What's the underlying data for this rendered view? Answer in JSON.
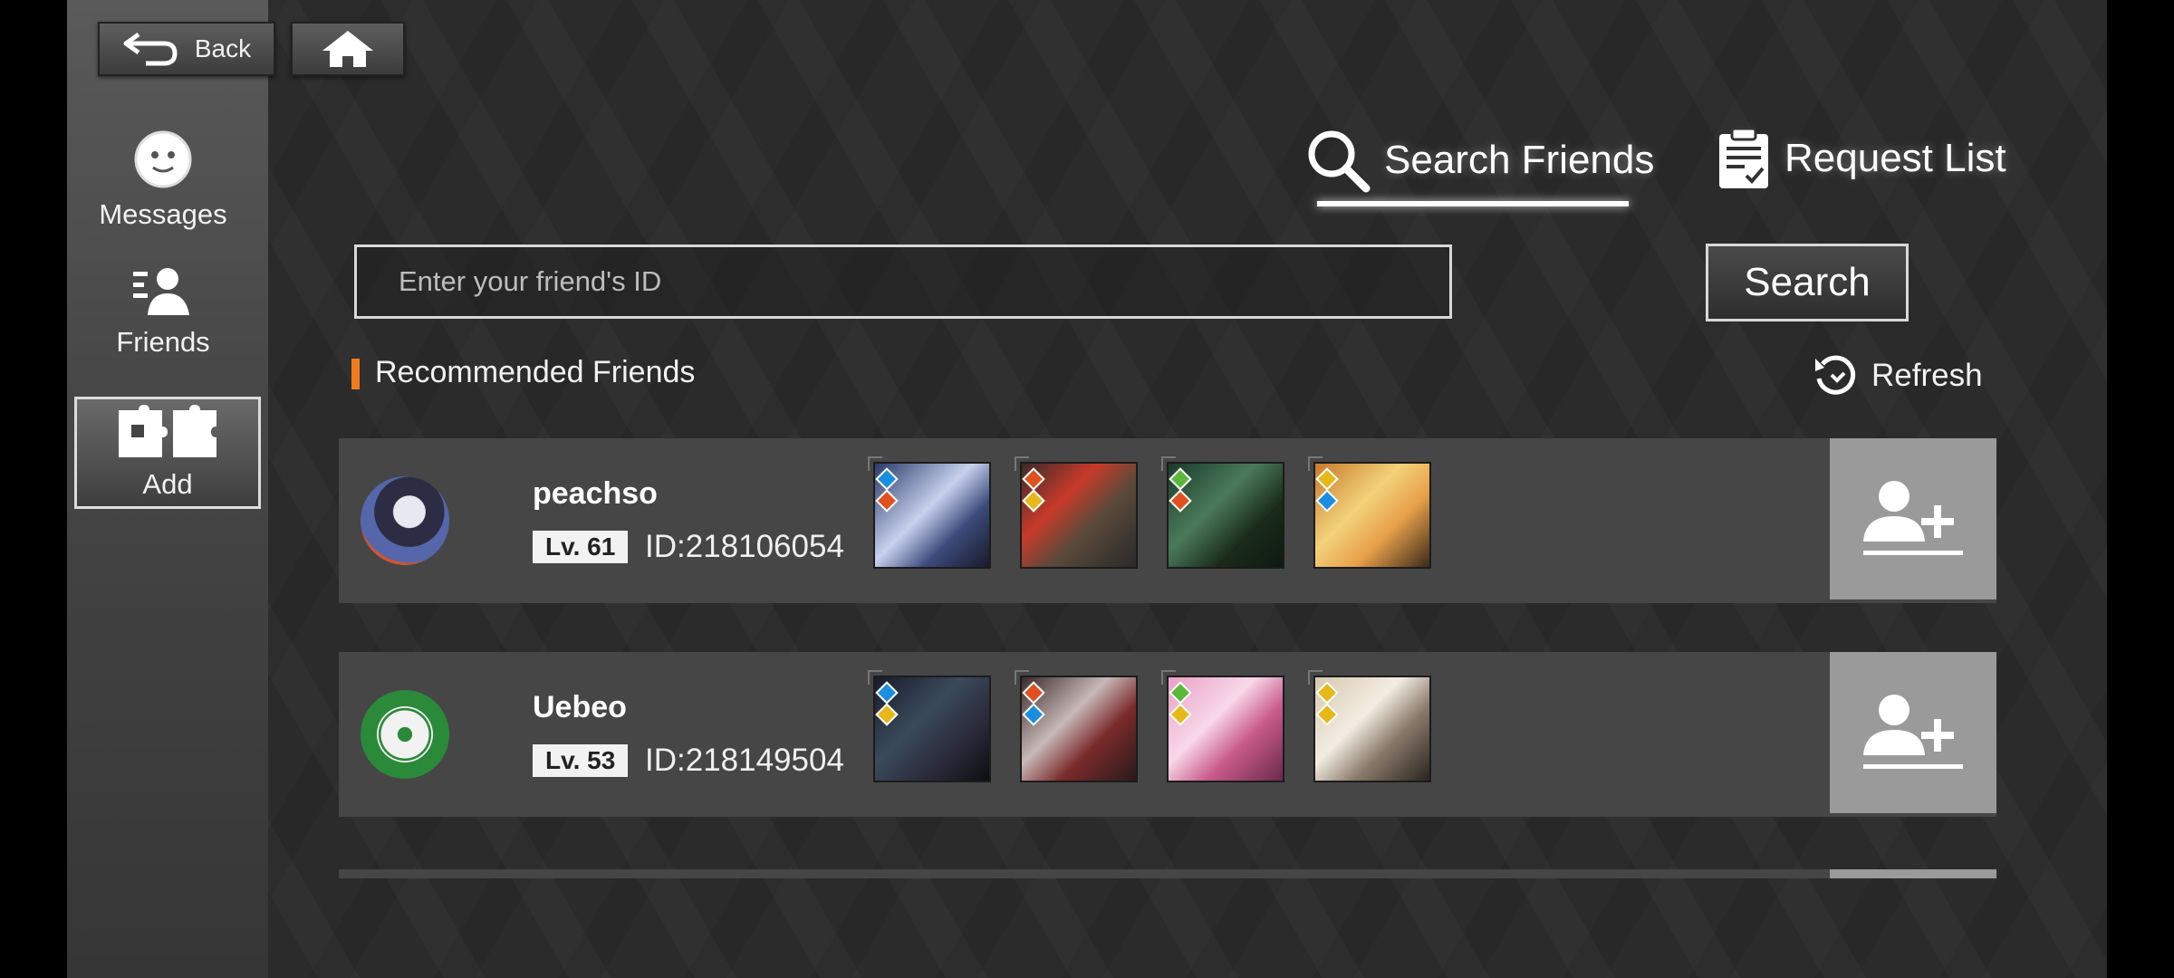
{
  "nav": {
    "back_label": "Back",
    "home_icon": "home-icon",
    "items": [
      {
        "label": "Messages",
        "icon": "smiley-icon"
      },
      {
        "label": "Friends",
        "icon": "friends-icon"
      },
      {
        "label": "Add",
        "icon": "puzzle-icon",
        "selected": true
      }
    ]
  },
  "tabs": {
    "search_label": "Search Friends",
    "request_label": "Request List",
    "active": "Search Friends"
  },
  "search": {
    "placeholder": "Enter your friend's ID",
    "value": "",
    "button_label": "Search"
  },
  "recommended": {
    "title": "Recommended Friends",
    "refresh_label": "Refresh",
    "accent_color": "#f07c1b",
    "players": [
      {
        "name": "peachso",
        "level": "Lv. 61",
        "id_text": "ID:218106054",
        "team_elements": [
          [
            "blue",
            "red"
          ],
          [
            "red",
            "yellow"
          ],
          [
            "green",
            "red"
          ],
          [
            "yellow",
            "blue"
          ]
        ]
      },
      {
        "name": "Uebeo",
        "level": "Lv. 53",
        "id_text": "ID:218149504",
        "team_elements": [
          [
            "blue",
            "yellow"
          ],
          [
            "red",
            "blue"
          ],
          [
            "green",
            "yellow"
          ],
          [
            "yellow",
            "yellow"
          ]
        ]
      }
    ]
  }
}
